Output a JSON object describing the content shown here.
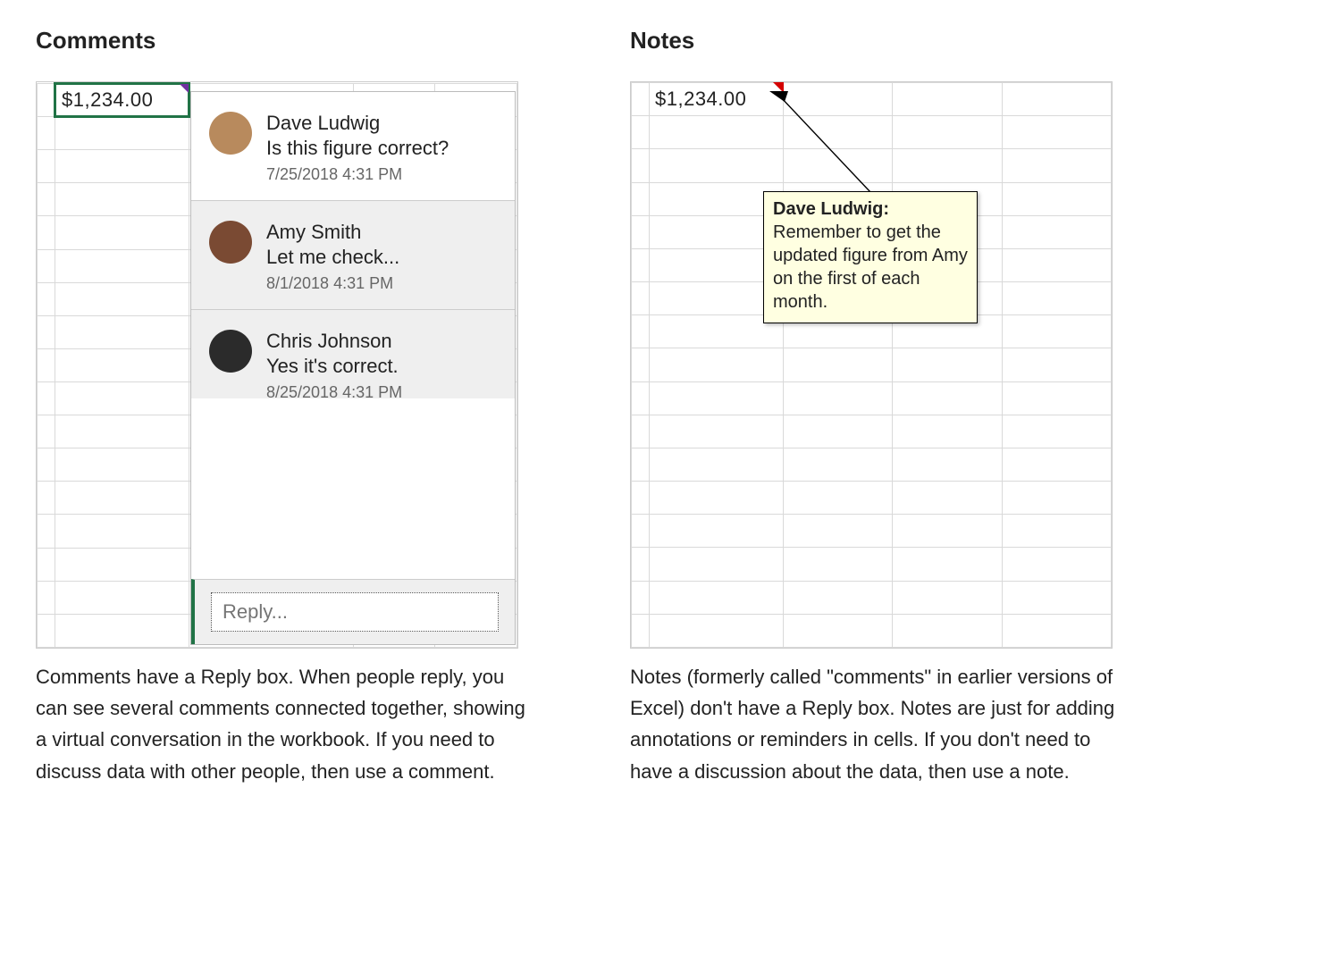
{
  "left": {
    "heading": "Comments",
    "cell_value": "$1,234.00",
    "thread": [
      {
        "author": "Dave Ludwig",
        "text": "Is this figure correct?",
        "time": "7/25/2018 4:31 PM",
        "avatar_bg": "#b88a5d"
      },
      {
        "author": "Amy Smith",
        "text": "Let me check...",
        "time": "8/1/2018 4:31 PM",
        "avatar_bg": "#7a4a33"
      },
      {
        "author": "Chris Johnson",
        "text": "Yes it's correct.",
        "time": "8/25/2018 4:31 PM",
        "avatar_bg": "#2b2b2b"
      }
    ],
    "reply_placeholder": "Reply...",
    "description": "Comments have a Reply box. When people reply, you can see several comments connected together, showing a virtual conversation in the workbook. If you need to discuss data with other people, then use a comment."
  },
  "right": {
    "heading": "Notes",
    "cell_value": "$1,234.00",
    "note_author": "Dave Ludwig:",
    "note_text": "Remember to get the updated figure from Amy on the first of each month.",
    "description": "Notes (formerly called \"comments\" in earlier versions of Excel) don't have a Reply box. Notes are just for adding annotations or reminders in cells. If you don't need to have a discussion about the data, then use a note."
  }
}
